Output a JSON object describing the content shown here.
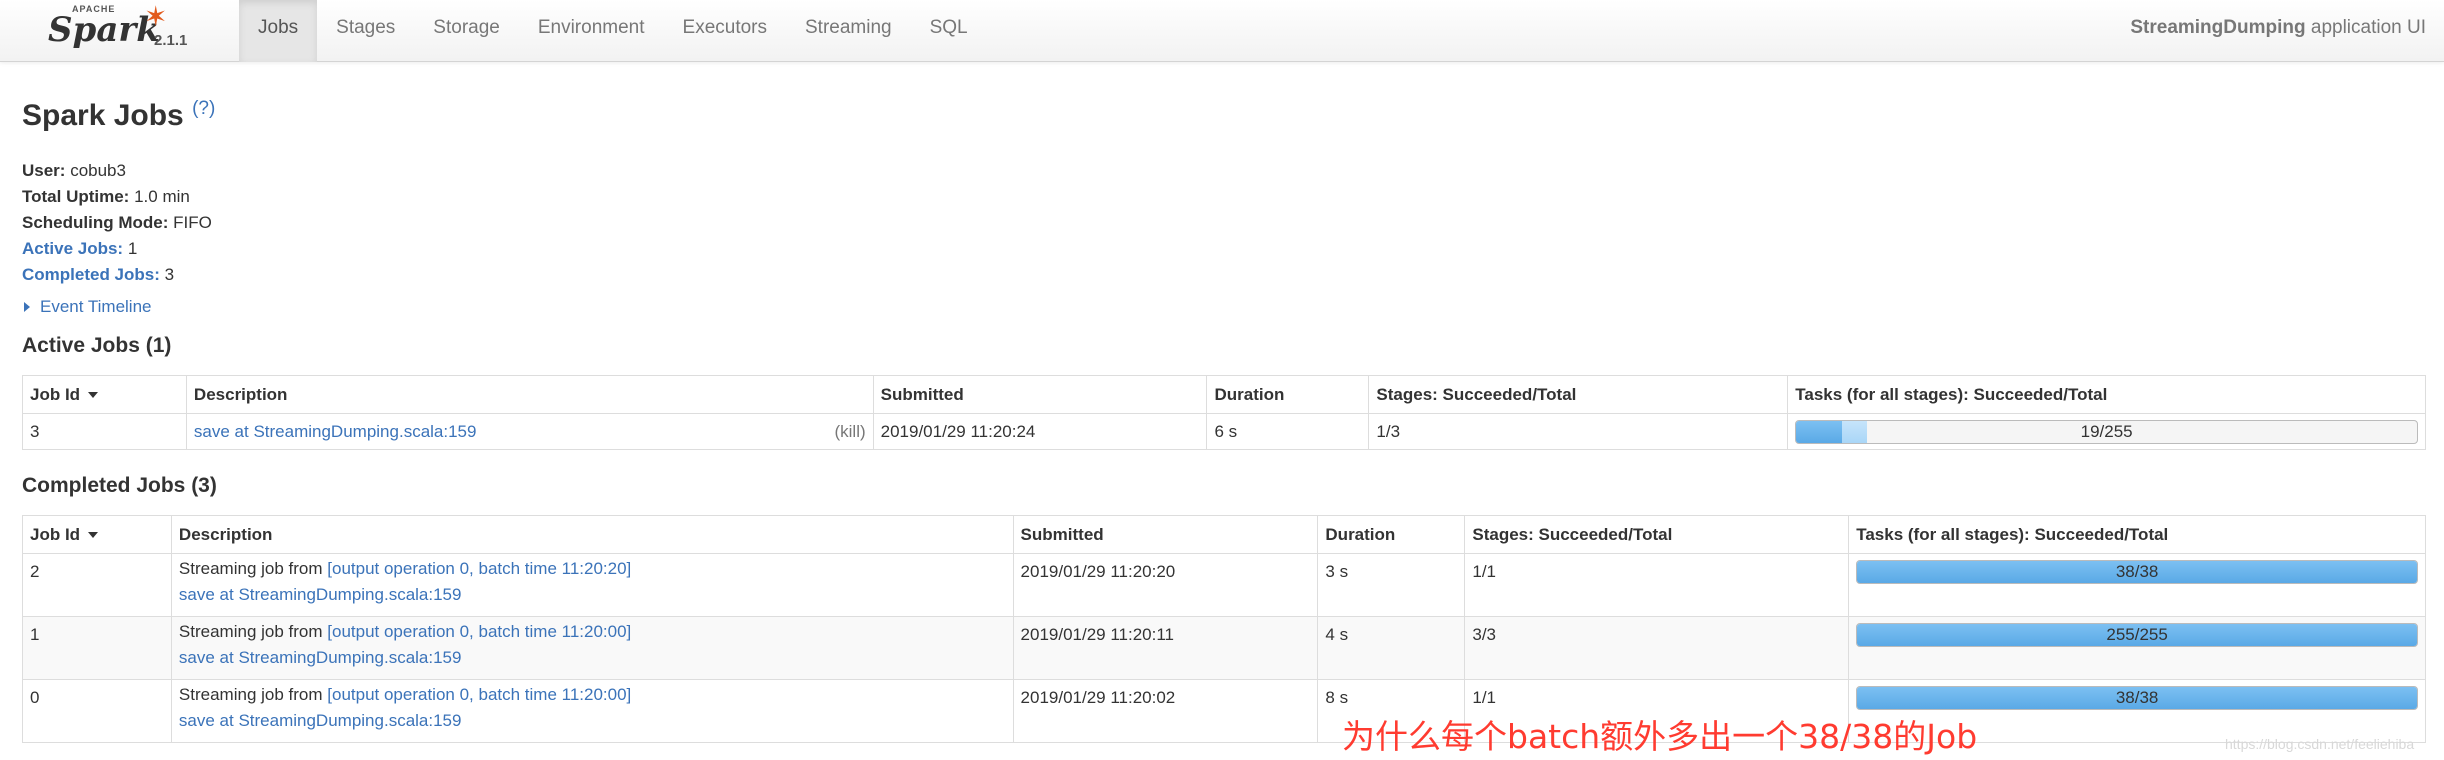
{
  "navbar": {
    "brand": {
      "apache": "APACHE",
      "name": "Spark",
      "version": "2.1.1"
    },
    "tabs": [
      {
        "label": "Jobs",
        "active": true
      },
      {
        "label": "Stages",
        "active": false
      },
      {
        "label": "Storage",
        "active": false
      },
      {
        "label": "Environment",
        "active": false
      },
      {
        "label": "Executors",
        "active": false
      },
      {
        "label": "Streaming",
        "active": false
      },
      {
        "label": "SQL",
        "active": false
      }
    ],
    "app_name": "StreamingDumping",
    "app_suffix": " application UI"
  },
  "page": {
    "title": "Spark Jobs",
    "help": "(?)"
  },
  "summary": {
    "user_label": "User:",
    "user_value": " cobub3",
    "uptime_label": "Total Uptime:",
    "uptime_value": " 1.0 min",
    "mode_label": "Scheduling Mode:",
    "mode_value": " FIFO",
    "active_label": "Active Jobs:",
    "active_value": " 1",
    "completed_label": "Completed Jobs:",
    "completed_value": " 3"
  },
  "event_timeline": "Event Timeline",
  "active_jobs": {
    "title": "Active Jobs (1)",
    "headers": [
      "Job Id",
      "Description",
      "Submitted",
      "Duration",
      "Stages: Succeeded/Total",
      "Tasks (for all stages): Succeeded/Total"
    ],
    "rows": [
      {
        "id": "3",
        "desc_link": "save at StreamingDumping.scala:159",
        "kill": "(kill)",
        "submitted": "2019/01/29 11:20:24",
        "duration": "6 s",
        "stages": "1/3",
        "tasks": "19/255",
        "done_fraction": 0.0745,
        "running_fraction": 0.04
      }
    ]
  },
  "completed_jobs": {
    "title": "Completed Jobs (3)",
    "headers": [
      "Job Id",
      "Description",
      "Submitted",
      "Duration",
      "Stages: Succeeded/Total",
      "Tasks (for all stages): Succeeded/Total"
    ],
    "rows": [
      {
        "id": "2",
        "desc_prefix": "Streaming job from ",
        "desc_batch": "[output operation 0, batch time 11:20:20]",
        "desc_link": "save at StreamingDumping.scala:159",
        "submitted": "2019/01/29 11:20:20",
        "duration": "3 s",
        "stages": "1/1",
        "tasks": "38/38",
        "done_fraction": 1.0
      },
      {
        "id": "1",
        "desc_prefix": "Streaming job from ",
        "desc_batch": "[output operation 0, batch time 11:20:00]",
        "desc_link": "save at StreamingDumping.scala:159",
        "submitted": "2019/01/29 11:20:11",
        "duration": "4 s",
        "stages": "3/3",
        "tasks": "255/255",
        "done_fraction": 1.0
      },
      {
        "id": "0",
        "desc_prefix": "Streaming job from ",
        "desc_batch": "[output operation 0, batch time 11:20:00]",
        "desc_link": "save at StreamingDumping.scala:159",
        "submitted": "2019/01/29 11:20:02",
        "duration": "8 s",
        "stages": "1/1",
        "tasks": "38/38",
        "done_fraction": 1.0
      }
    ]
  },
  "annotation": "为什么每个batch额外多出一个38/38的Job",
  "watermark": "https://blog.csdn.net/feeliehiba",
  "colors": {
    "link": "#3b73b9",
    "progress_done": "#5aa9e6",
    "progress_running": "#a9d6f7",
    "annotation": "#ff3b30",
    "spark_star": "#e25a1c"
  }
}
